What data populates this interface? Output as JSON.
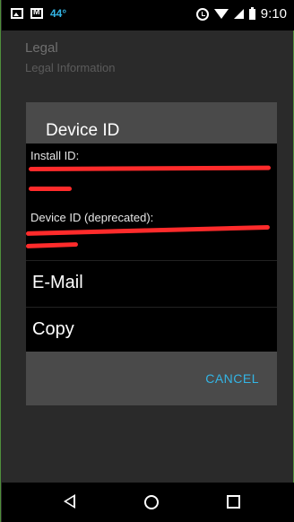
{
  "status_bar": {
    "temperature": "44°",
    "time": "9:10",
    "icons": [
      "image-icon",
      "mail-icon",
      "alarm-icon",
      "wifi-icon",
      "signal-icon",
      "battery-icon"
    ]
  },
  "app": {
    "title": "Legal",
    "subtitle": "Legal Information"
  },
  "dialog": {
    "title": "Device ID",
    "install_id_label": "Install ID:",
    "device_id_label": "Device ID (deprecated):",
    "options": [
      "E-Mail",
      "Copy"
    ],
    "cancel_label": "CANCEL"
  },
  "colors": {
    "accent": "#33b5e5",
    "redaction": "#ff2b2b",
    "dialog_bg": "#4a4a4a",
    "content_bg": "#000000"
  },
  "nav_bar": {
    "icons": [
      "back-icon",
      "home-icon",
      "recents-icon"
    ]
  }
}
